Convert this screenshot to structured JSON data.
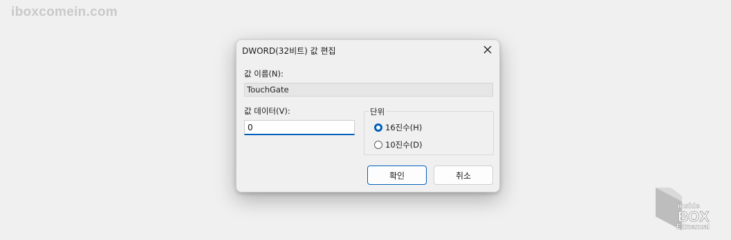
{
  "watermark": {
    "text": "iboxcomein.com"
  },
  "dialog": {
    "title": "DWORD(32비트) 값 편집",
    "value_name_label": "값 이름(N):",
    "value_name": "TouchGate",
    "value_data_label": "값 데이터(V):",
    "value_data": "0",
    "base_group": {
      "legend": "단위",
      "options": [
        {
          "label": "16진수(H)",
          "checked": true
        },
        {
          "label": "10진수(D)",
          "checked": false
        }
      ]
    },
    "ok_label": "확인",
    "cancel_label": "취소"
  },
  "logo": {
    "line1": "inside",
    "line2": "BOX",
    "line3": "EZmanual"
  },
  "colors": {
    "accent": "#005fb8",
    "background": "#f0f0f0"
  }
}
